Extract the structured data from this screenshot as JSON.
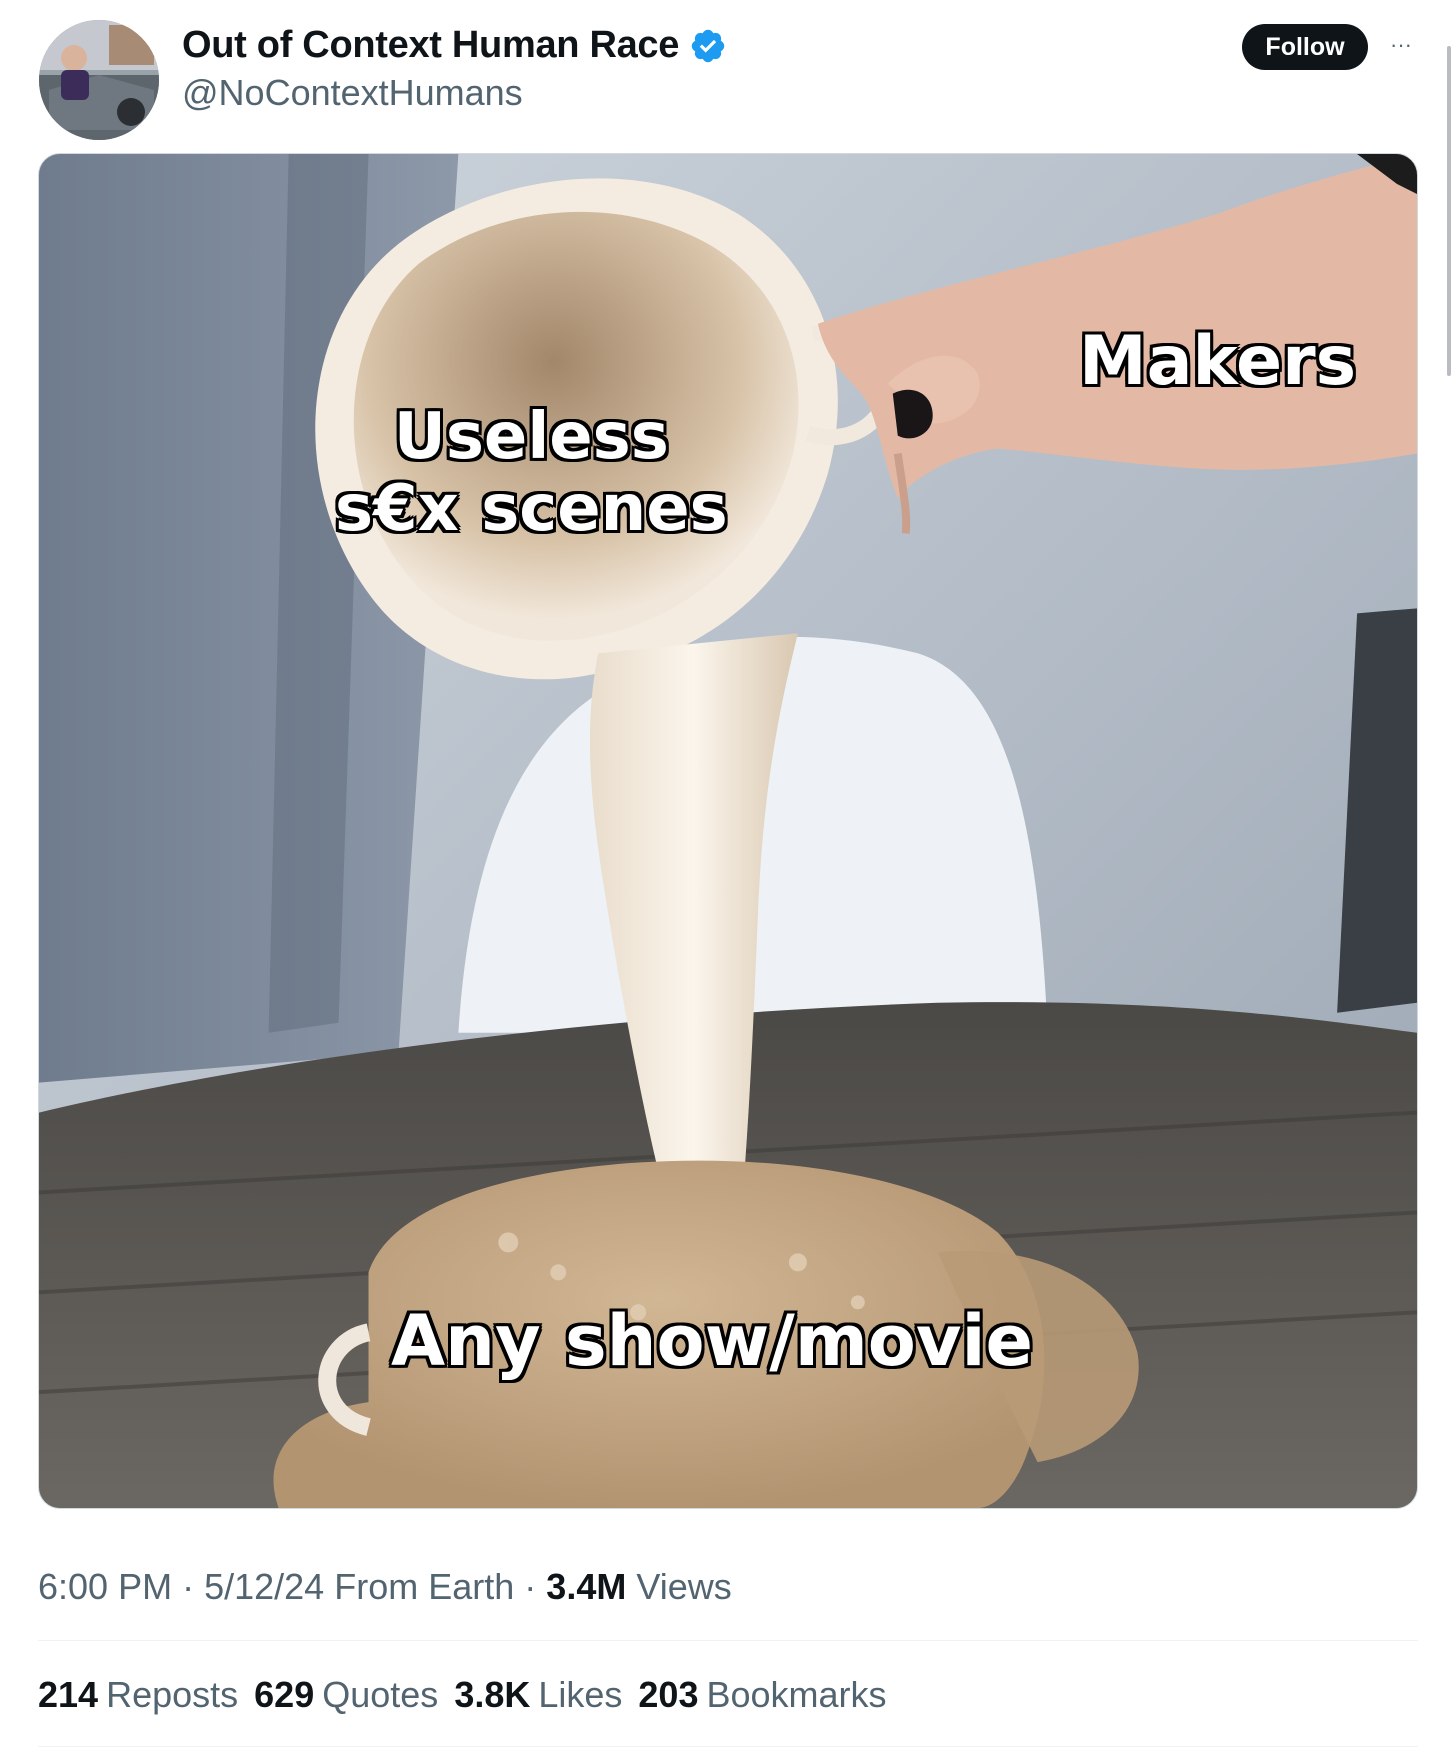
{
  "author": {
    "display_name": "Out of Context Human Race",
    "handle": "@NoContextHumans",
    "verified": true
  },
  "actions": {
    "follow_label": "Follow",
    "more_label": "···"
  },
  "media": {
    "captions": {
      "cup": "Useless\ns€x scenes",
      "hand": "Makers",
      "bottom": "Any show/movie"
    }
  },
  "meta": {
    "time": "6:00 PM",
    "date": "5/12/24",
    "source": "From Earth",
    "views_count": "3.4M",
    "views_label": "Views"
  },
  "stats": [
    {
      "count": "214",
      "label": "Reposts"
    },
    {
      "count": "629",
      "label": "Quotes"
    },
    {
      "count": "3.8K",
      "label": "Likes"
    },
    {
      "count": "203",
      "label": "Bookmarks"
    }
  ],
  "colors": {
    "verified_blue": "#1d9bf0",
    "text_primary": "#0f1419",
    "text_secondary": "#536471"
  }
}
